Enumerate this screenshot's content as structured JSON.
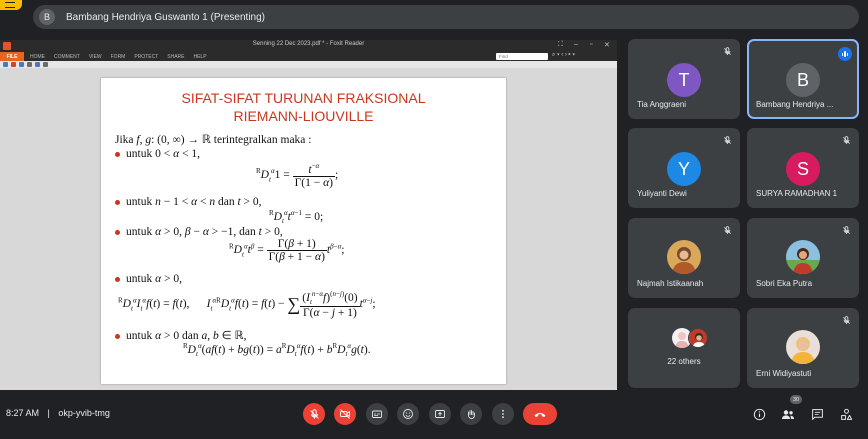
{
  "presenter_bar": {
    "avatar_letter": "B",
    "text": "Bambang Hendriya Guswanto 1 (Presenting)"
  },
  "reader": {
    "title": "Senning 22 Dec 2023.pdf * - Foxit Reader",
    "file_tab": "FILE",
    "menu": [
      "HOME",
      "COMMENT",
      "VIEW",
      "FORM",
      "PROTECT",
      "SHARE",
      "HELP"
    ],
    "find_placeholder": "Find"
  },
  "slide": {
    "title_line1": "SIFAT-SIFAT TURUNAN FRAKSIONAL",
    "title_line2": "RIEMANN-LIOUVILLE",
    "intro": "terintegralkan maka :",
    "b1_label": "untuk",
    "b2_label": "untuk",
    "b2_dan": "dan",
    "b3_label": "untuk",
    "b3_dan": ", dan",
    "b4_label": "untuk",
    "b5_label": "untuk",
    "b5_dan": "dan"
  },
  "participants": [
    {
      "letter": "T",
      "name": "Tia Anggraeni",
      "color": "#7e57c2"
    },
    {
      "letter": "B",
      "name": "Bambang Hendriya ...",
      "color": "#5f6368"
    },
    {
      "letter": "Y",
      "name": "Yuliyanti Dewi",
      "color": "#1e88e5"
    },
    {
      "letter": "S",
      "name": "SURYA RAMADHAN 1",
      "color": "#d81b60"
    },
    {
      "name": "Najmah Istikaanah"
    },
    {
      "name": "Sobri Eka Putra"
    },
    {
      "name": "22 others"
    },
    {
      "name": "Erni Widiyastuti"
    }
  ],
  "meeting": {
    "time": "8:27 AM",
    "separator": "|",
    "code": "okp-yvib-tmg",
    "participant_count": "30"
  },
  "colors": {
    "background": "#202124",
    "tile": "#3c4043",
    "accent": "#8ab4f8",
    "danger": "#ea4335",
    "slide_title": "#c8371f"
  },
  "icons": [
    "mic-off-icon",
    "camera-off-icon",
    "captions-icon",
    "emoji-icon",
    "present-icon",
    "raise-hand-icon",
    "more-icon",
    "hangup-icon",
    "info-icon",
    "people-icon",
    "chat-icon",
    "activities-icon"
  ]
}
